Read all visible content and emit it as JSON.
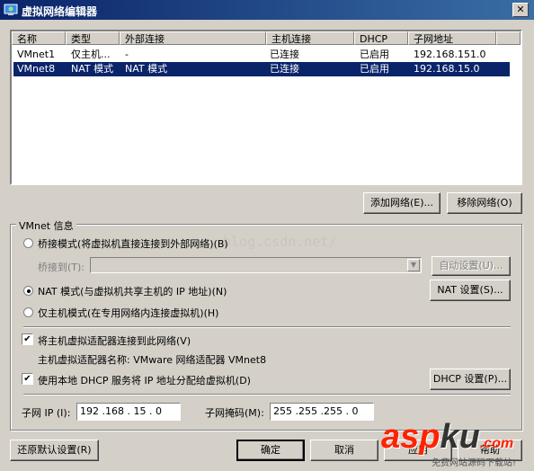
{
  "window": {
    "title": "虚拟网络编辑器",
    "close_glyph": "✕"
  },
  "list": {
    "columns": [
      "名称",
      "类型",
      "外部连接",
      "主机连接",
      "DHCP",
      "子网地址"
    ],
    "rows": [
      [
        "VMnet1",
        "仅主机...",
        "-",
        "已连接",
        "已启用",
        "192.168.151.0"
      ],
      [
        "VMnet8",
        "NAT 模式",
        "NAT 模式",
        "已连接",
        "已启用",
        "192.168.15.0"
      ]
    ],
    "selected_row": 1
  },
  "buttons": {
    "add_network": "添加网络(E)...",
    "remove_network": "移除网络(O)",
    "auto_settings": "自动设置(U)...",
    "nat_settings": "NAT 设置(S)...",
    "dhcp_settings": "DHCP 设置(P)...",
    "restore_defaults": "还原默认设置(R)",
    "ok": "确定",
    "cancel": "取消",
    "apply": "应用",
    "help": "帮助"
  },
  "vmnet_info": {
    "group_label": "VMnet 信息",
    "bridged_label": "桥接模式(将虚拟机直接连接到外部网络)(B)",
    "bridged_to_label": "桥接到(T):",
    "bridged_to_value": "",
    "nat_label": "NAT 模式(与虚拟机共享主机的 IP 地址)(N)",
    "hostonly_label": "仅主机模式(在专用网络内连接虚拟机)(H)",
    "selected_mode": "nat",
    "connect_adapter_label": "将主机虚拟适配器连接到此网络(V)",
    "connect_adapter_checked": true,
    "adapter_name_text": "主机虚拟适配器名称: VMware 网络适配器 VMnet8",
    "use_dhcp_label": "使用本地 DHCP 服务将 IP 地址分配给虚拟机(D)",
    "use_dhcp_checked": true,
    "subnet_ip_label": "子网 IP (I):",
    "subnet_ip_value": "192 .168 . 15  .  0",
    "subnet_mask_label": "子网掩码(M):",
    "subnet_mask_value": "255 .255 .255 .  0"
  },
  "overlay": {
    "watermark_text": "blog.csdn.net/",
    "logo_part1": "asp",
    "logo_part2": "ku",
    "logo_suffix": ".com",
    "logo_sub": "免费网站源码下载站!"
  }
}
